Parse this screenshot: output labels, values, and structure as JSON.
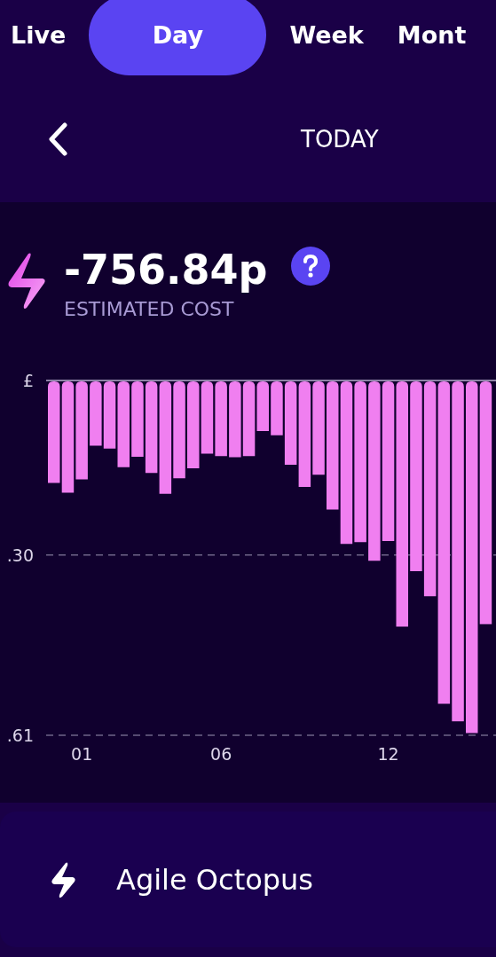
{
  "tabs": [
    {
      "label": "Live",
      "selected": false
    },
    {
      "label": "Day",
      "selected": true
    },
    {
      "label": "Week",
      "selected": false
    },
    {
      "label": "Mont",
      "selected": false
    }
  ],
  "period": {
    "label": "TODAY"
  },
  "summary": {
    "value": "-756.84p",
    "caption": "ESTIMATED COST"
  },
  "chart_data": {
    "type": "bar",
    "values": [
      -0.176,
      -0.193,
      -0.17,
      -0.112,
      -0.117,
      -0.149,
      -0.131,
      -0.159,
      -0.195,
      -0.168,
      -0.151,
      -0.126,
      -0.13,
      -0.132,
      -0.13,
      -0.087,
      -0.094,
      -0.145,
      -0.183,
      -0.162,
      -0.222,
      -0.281,
      -0.278,
      -0.31,
      -0.276,
      -0.423,
      -0.328,
      -0.371,
      -0.556,
      -0.586,
      -0.606,
      -0.419
    ],
    "ylim": [
      -0.61,
      0
    ],
    "yticks": [
      {
        "value": 0,
        "label": "£"
      },
      {
        "value": -0.3,
        "label": ".30"
      },
      {
        "value": -0.61,
        "label": ".61"
      }
    ],
    "categories": [
      null,
      null,
      "01",
      null,
      null,
      null,
      null,
      null,
      null,
      null,
      null,
      null,
      "06",
      null,
      null,
      null,
      null,
      null,
      null,
      null,
      null,
      null,
      null,
      null,
      "12",
      null,
      null,
      null,
      null,
      null,
      null,
      null
    ]
  },
  "tariff": {
    "name": "Agile Octopus"
  }
}
